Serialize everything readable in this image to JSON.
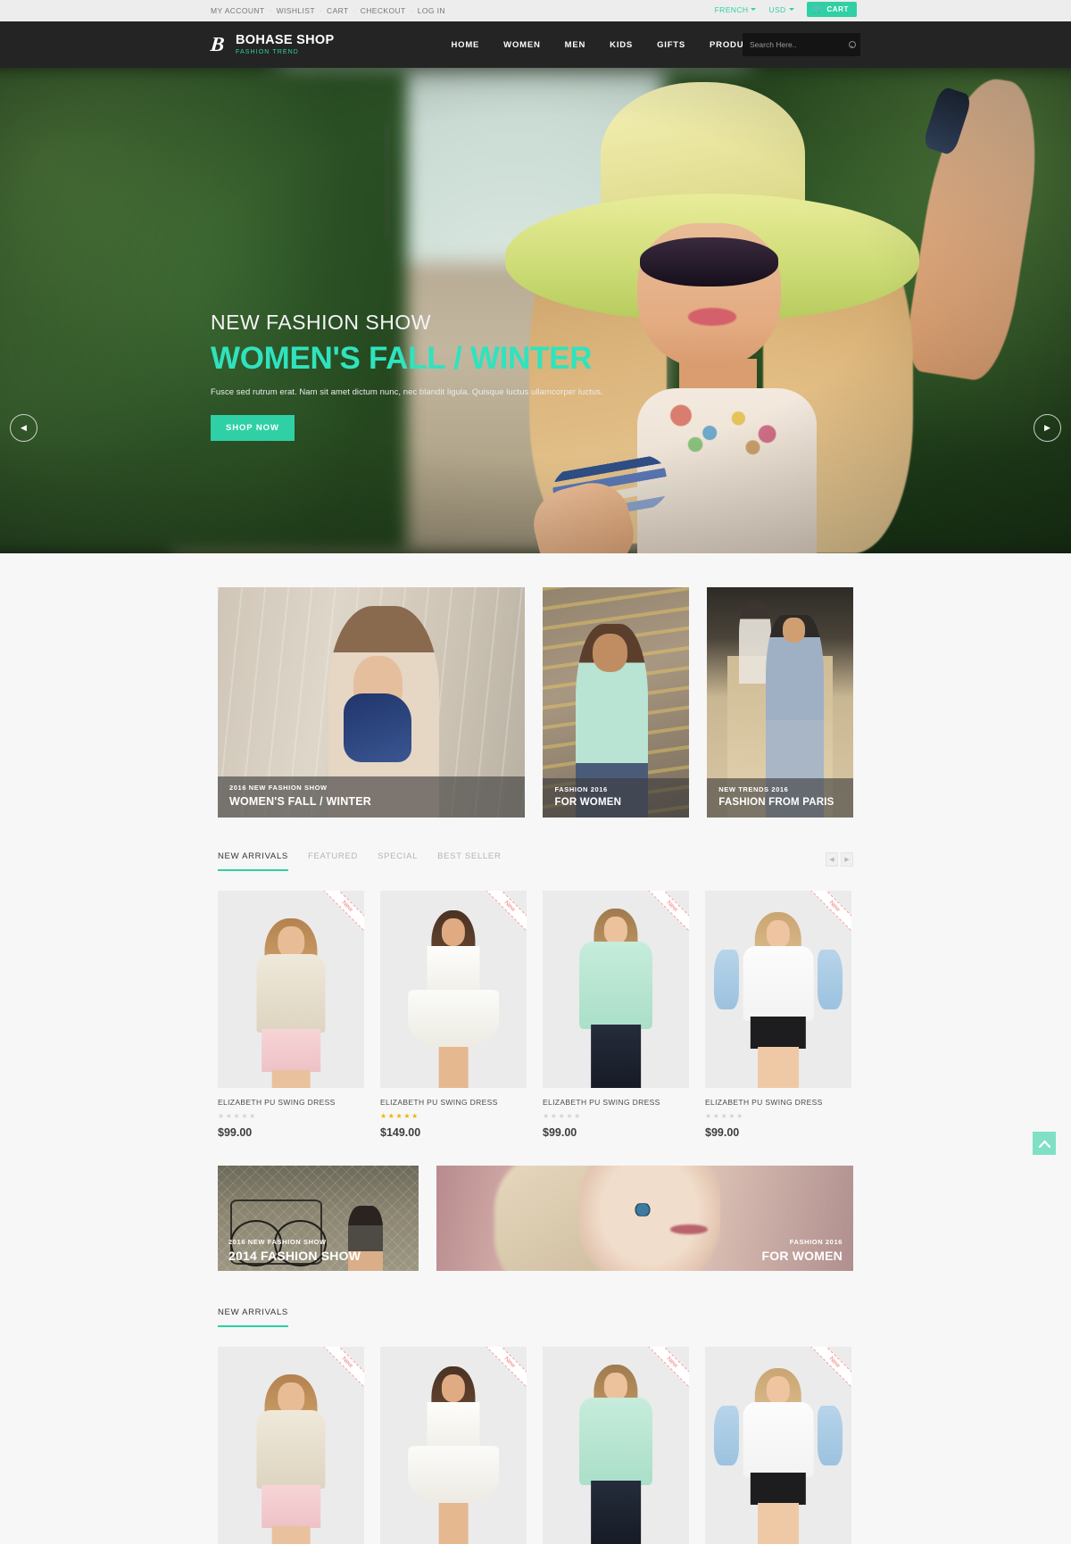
{
  "topbar": {
    "links": [
      "MY ACCOUNT",
      "WISHLIST",
      "CART",
      "CHECKOUT",
      "LOG IN"
    ],
    "language": "FRENCH",
    "currency": "USD",
    "cart_label": "CART",
    "cart_icon": "cart-icon",
    "accent": "#2fd0a5"
  },
  "header": {
    "logo_name": "BOHASE SHOP",
    "logo_tagline": "FASHION TREND",
    "logo_mark": "B",
    "nav": [
      "HOME",
      "WOMEN",
      "MEN",
      "KIDS",
      "GIFTS",
      "PRODUCTS"
    ],
    "search": {
      "placeholder": "Search Here..",
      "value": "",
      "icon": "search-icon"
    },
    "background": "#242424"
  },
  "hero": {
    "subtitle": "NEW FASHION SHOW",
    "title": "WOMEN'S FALL / WINTER",
    "description": "Fusce sed rutrum erat. Nam sit amet dictum nunc, nec blandit ligula. Quisque luctus ullamcorper luctus.",
    "button": "SHOP NOW",
    "prev_icon": "chevron-left-icon",
    "next_icon": "chevron-right-icon",
    "title_color": "#2fe3bd"
  },
  "promos": [
    {
      "sub": "2016 NEW FASHION SHOW",
      "title": "WOMEN'S FALL / WINTER"
    },
    {
      "sub": "FASHION 2016",
      "title": "FOR WOMEN"
    },
    {
      "sub": "NEW TRENDS 2016",
      "title": "FASHION FROM PARIS"
    }
  ],
  "tabs": {
    "items": [
      {
        "label": "NEW ARRIVALS",
        "active": true
      },
      {
        "label": "FEATURED",
        "active": false
      },
      {
        "label": "SPECIAL",
        "active": false
      },
      {
        "label": "BEST SELLER",
        "active": false
      }
    ],
    "prev_icon": "arrow-left-icon",
    "next_icon": "arrow-right-icon"
  },
  "products": [
    {
      "name": "ELIZABETH PU SWING DRESS",
      "price": "$99.00",
      "rating": 0,
      "badge": "New"
    },
    {
      "name": "ELIZABETH PU SWING DRESS",
      "price": "$149.00",
      "rating": 5,
      "badge": "New"
    },
    {
      "name": "ELIZABETH PU SWING DRESS",
      "price": "$99.00",
      "rating": 0,
      "badge": "New"
    },
    {
      "name": "ELIZABETH PU SWING DRESS",
      "price": "$99.00",
      "rating": 0,
      "badge": "New"
    }
  ],
  "mid_banners": [
    {
      "sub": "2016 NEW FASHION SHOW",
      "title": "2014 FASHION SHOW"
    },
    {
      "sub": "FASHION 2016",
      "title": "FOR WOMEN"
    }
  ],
  "new_arrivals_section": {
    "title": "NEW ARRIVALS"
  },
  "bottom_products": [
    {
      "badge": "New"
    },
    {
      "badge": "New"
    },
    {
      "badge": "New"
    },
    {
      "badge": "New"
    }
  ],
  "scroll_top": {
    "icon": "chevron-up-icon",
    "color": "#7fe0c6"
  },
  "stars_glyph": "★★★★★"
}
